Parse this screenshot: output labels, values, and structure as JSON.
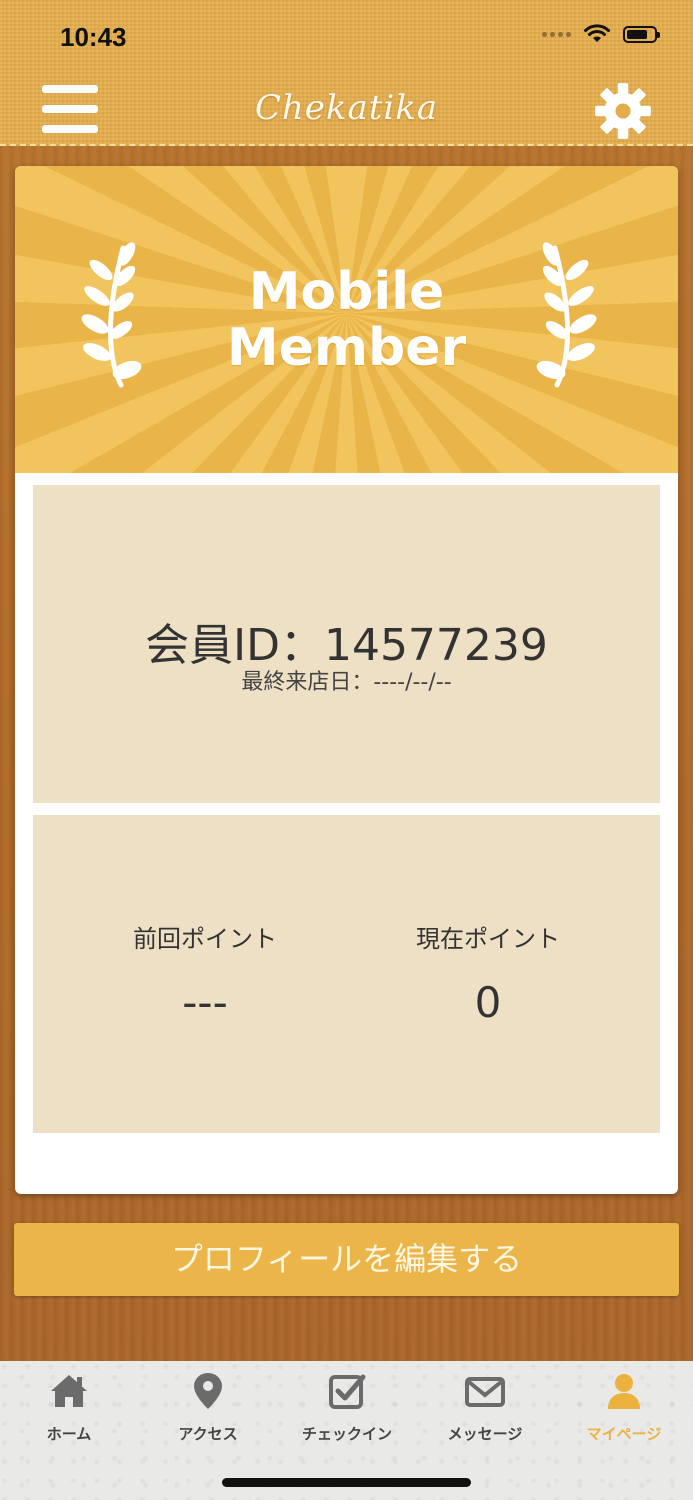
{
  "status_bar": {
    "time": "10:43"
  },
  "header": {
    "app_name": "Chekatika"
  },
  "banner": {
    "title_line1": "Mobile",
    "title_line2": "Member"
  },
  "member": {
    "id_text": "会員ID：14577239",
    "last_visit_text": "最終来店日：----/--/--"
  },
  "points": {
    "previous_label": "前回ポイント",
    "previous_value": "---",
    "current_label": "現在ポイント",
    "current_value": "0"
  },
  "edit_profile_label": "プロフィールを編集する",
  "tabs": [
    {
      "label": "ホーム",
      "icon": "home-icon",
      "active": false
    },
    {
      "label": "アクセス",
      "icon": "map-pin-icon",
      "active": false
    },
    {
      "label": "チェックイン",
      "icon": "checkbox-icon",
      "active": false
    },
    {
      "label": "メッセージ",
      "icon": "envelope-icon",
      "active": false
    },
    {
      "label": "マイページ",
      "icon": "user-icon",
      "active": true
    }
  ],
  "colors": {
    "accent": "#ebb54a",
    "active_tab": "#ecb23f",
    "panel": "#ede0c4"
  }
}
